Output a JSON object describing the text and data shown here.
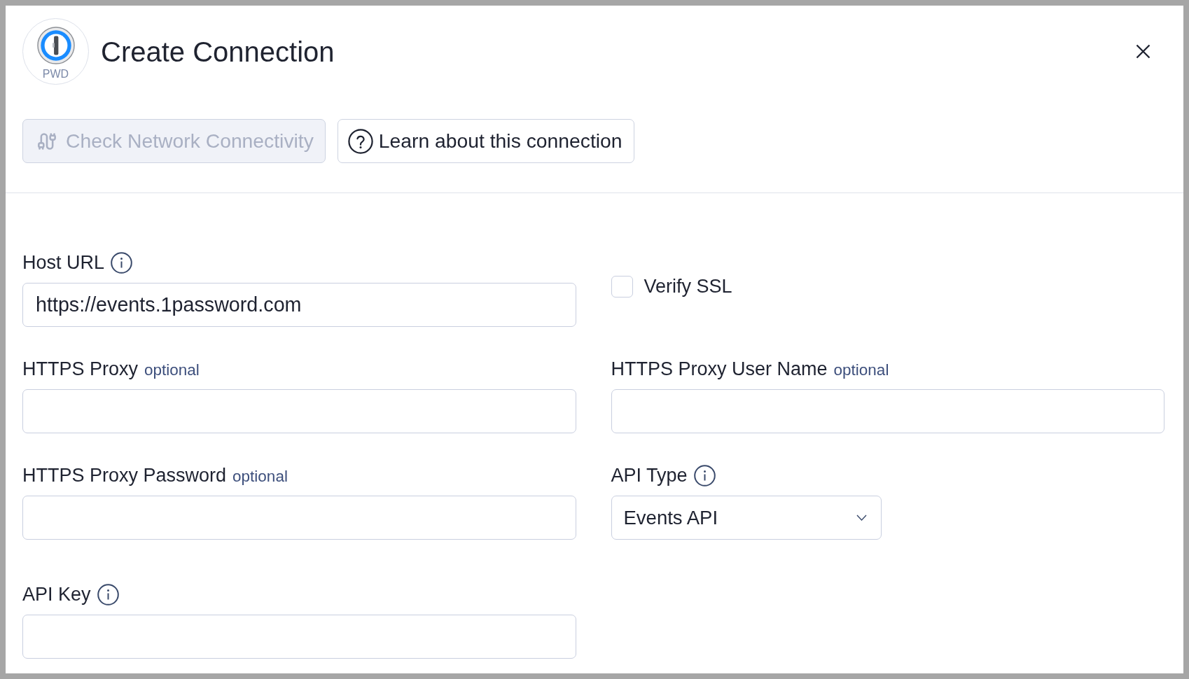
{
  "dialog": {
    "logo_caption": "PWD",
    "title": "Create Connection"
  },
  "actions": [
    {
      "label": "Check Network Connectivity",
      "disabled": true
    },
    {
      "label": "Learn about this connection",
      "disabled": false
    }
  ],
  "form": {
    "fields": [
      {
        "kind": "text",
        "label": "Host URL",
        "info": true,
        "value": "https://events.1password.com"
      },
      {
        "kind": "checkbox",
        "label": "Verify SSL",
        "checked": false
      },
      {
        "kind": "text",
        "label": "HTTPS Proxy",
        "note": "optional",
        "info": false
      },
      {
        "kind": "text",
        "label": "HTTPS Proxy User Name",
        "note": "optional",
        "info": false
      },
      {
        "kind": "text",
        "label": "HTTPS Proxy Password",
        "note": "optional",
        "info": false
      },
      {
        "kind": "select",
        "label": "API Type",
        "info": true,
        "value": "Events API"
      },
      {
        "kind": "text",
        "label": "API Key",
        "info": true
      }
    ]
  }
}
